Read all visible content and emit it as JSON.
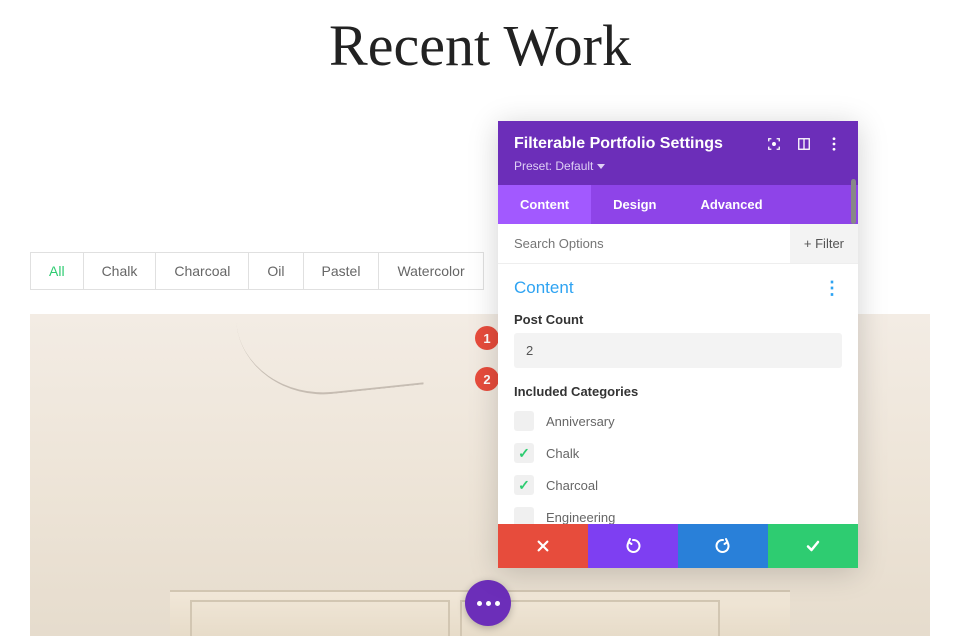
{
  "page": {
    "title": "Recent Work"
  },
  "filters": [
    {
      "label": "All",
      "active": true
    },
    {
      "label": "Chalk",
      "active": false
    },
    {
      "label": "Charcoal",
      "active": false
    },
    {
      "label": "Oil",
      "active": false
    },
    {
      "label": "Pastel",
      "active": false
    },
    {
      "label": "Watercolor",
      "active": false
    }
  ],
  "annotations": [
    "1",
    "2"
  ],
  "panel": {
    "title": "Filterable Portfolio Settings",
    "preset_label": "Preset: Default",
    "tabs": [
      {
        "label": "Content",
        "active": true
      },
      {
        "label": "Design",
        "active": false
      },
      {
        "label": "Advanced",
        "active": false
      }
    ],
    "search_placeholder": "Search Options",
    "filter_button": "+  Filter",
    "section_title": "Content",
    "post_count_label": "Post Count",
    "post_count_value": "2",
    "categories_label": "Included Categories",
    "categories": [
      {
        "label": "Anniversary",
        "checked": false
      },
      {
        "label": "Chalk",
        "checked": true
      },
      {
        "label": "Charcoal",
        "checked": true
      },
      {
        "label": "Engineering",
        "checked": false
      }
    ],
    "colors": {
      "header": "#6c2eb9",
      "tabs_bg": "#8e44e8",
      "tab_active": "#a259ff",
      "cancel": "#e74c3c",
      "undo": "#7e3ff2",
      "redo": "#2980d9",
      "save": "#2ecc71"
    }
  }
}
